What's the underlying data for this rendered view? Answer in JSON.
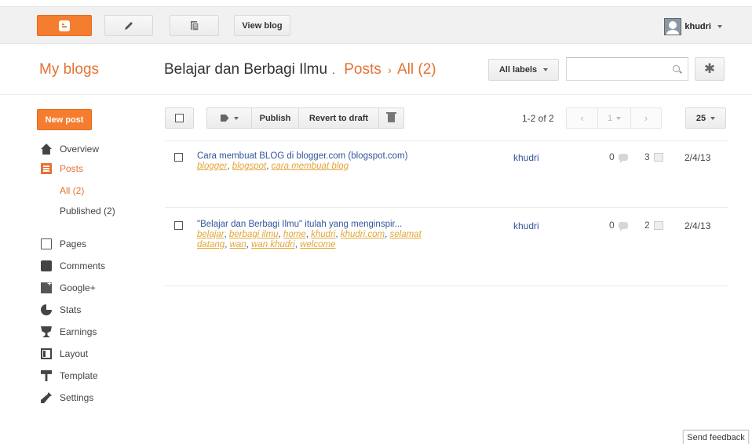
{
  "topbar": {
    "view_blog_label": "View blog",
    "username": "khudri",
    "icons": [
      "blogger-logo-icon",
      "pencil-icon",
      "copy-icon",
      "avatar",
      "chevron-down-icon"
    ]
  },
  "header": {
    "my_blogs": "My blogs",
    "blog_title": "Belajar dan Berbagi Ilmu",
    "title_separator": ".",
    "crumb_posts": "Posts",
    "crumb_arrow": "›",
    "crumb_all": "All (2)",
    "all_labels_button": "All labels",
    "search_placeholder": ""
  },
  "sidebar": {
    "new_post_label": "New post",
    "items": [
      {
        "label": "Overview",
        "icon": "home-icon"
      },
      {
        "label": "Posts",
        "icon": "posts-icon",
        "active": true
      },
      {
        "label": "Pages",
        "icon": "pages-icon"
      },
      {
        "label": "Comments",
        "icon": "comments-icon"
      },
      {
        "label": "Google+",
        "icon": "google-plus-icon"
      },
      {
        "label": "Stats",
        "icon": "stats-icon"
      },
      {
        "label": "Earnings",
        "icon": "trophy-icon"
      },
      {
        "label": "Layout",
        "icon": "layout-icon"
      },
      {
        "label": "Template",
        "icon": "paint-roller-icon"
      },
      {
        "label": "Settings",
        "icon": "wrench-icon"
      }
    ],
    "sub_items": [
      {
        "label": "All (2)",
        "active": true
      },
      {
        "label": "Published (2)"
      }
    ]
  },
  "toolbar": {
    "publish_label": "Publish",
    "revert_label": "Revert to draft",
    "count_label": "1-2 of 2",
    "prev_label": "‹",
    "page_label": "1",
    "next_label": "›",
    "per_page_label": "25",
    "accent_color": "#f57d2f"
  },
  "posts": [
    {
      "title": "Cara membuat BLOG di blogger.com (blogspot.com)",
      "tags": [
        "blogger",
        "blogspot",
        "cara membuat blog"
      ],
      "author": "khudri",
      "comments": "0",
      "views": "3",
      "date": "2/4/13"
    },
    {
      "title": "\"Belajar dan Berbagi Ilmu\" itulah yang menginspir...",
      "tags": [
        "belajar",
        "berbagi ilmu",
        "home",
        "khudri",
        "khudri.com",
        "selamat datang",
        "wan",
        "wan khudri",
        "welcome"
      ],
      "author": "khudri",
      "comments": "0",
      "views": "2",
      "date": "2/4/13"
    }
  ],
  "feedback_label": "Send feedback"
}
